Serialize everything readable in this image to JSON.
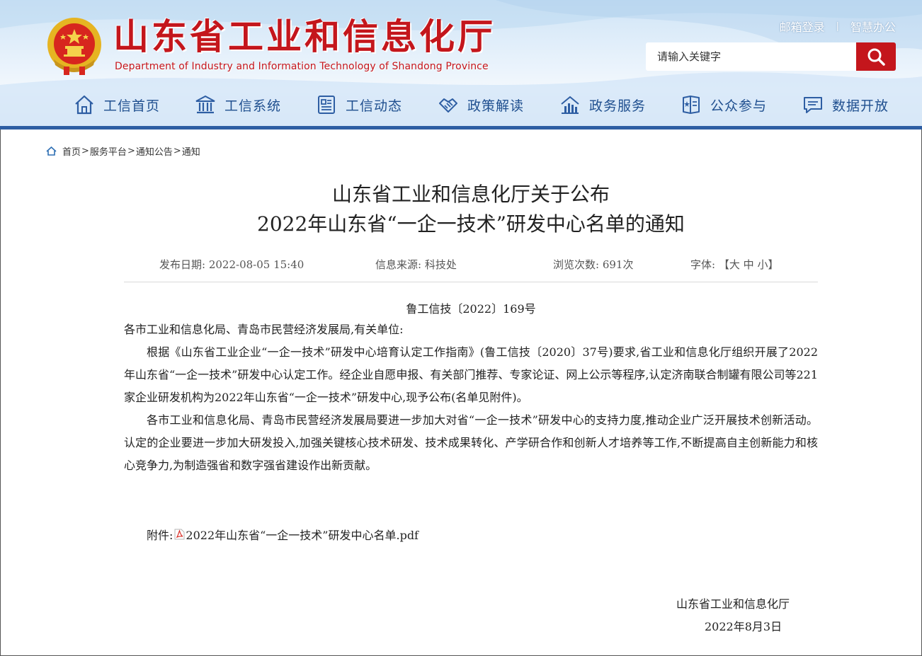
{
  "header": {
    "site_title": "山东省工业和信息化厅",
    "site_subtitle": "Department of Industry and Information Technology of Shandong Province",
    "links": {
      "mail_login": "邮箱登录",
      "separator": "|",
      "smart_office": "智慧办公"
    },
    "search": {
      "placeholder": "请输入关键字"
    },
    "nav": [
      {
        "label": "工信首页",
        "icon": "house-icon"
      },
      {
        "label": "工信系统",
        "icon": "building-icon"
      },
      {
        "label": "工信动态",
        "icon": "newspaper-icon"
      },
      {
        "label": "政策解读",
        "icon": "handshake-icon"
      },
      {
        "label": "政务服务",
        "icon": "chart-building-icon"
      },
      {
        "label": "公众参与",
        "icon": "booklet-icon"
      },
      {
        "label": "数据开放",
        "icon": "chat-icon"
      }
    ],
    "colors": {
      "brand_red": "#c4161c",
      "nav_blue": "#1f4f8f",
      "bar_blue": "#2e5ea3"
    }
  },
  "breadcrumb": {
    "items": [
      "首页",
      "服务平台",
      "通知公告",
      "通知"
    ],
    "separator": ">"
  },
  "article": {
    "title_line1": "山东省工业和信息化厅关于公布",
    "title_line2": "2022年山东省“一企一技术”研发中心名单的通知",
    "meta": {
      "publish_label": "发布日期:",
      "publish_date": "2022-08-05 15:40",
      "source_label": "信息来源:",
      "source": "科技处",
      "views_label": "浏览次数:",
      "views": "691次",
      "font_label": "字体:",
      "font_open": "【",
      "font_large": "大",
      "font_medium": "中",
      "font_small": "小",
      "font_close": "】"
    },
    "doc_number": "鲁工信技〔2022〕169号",
    "addressee": "各市工业和信息化局、青岛市民营经济发展局,有关单位:",
    "paragraph1": "根据《山东省工业企业“一企一技术”研发中心培育认定工作指南》(鲁工信技〔2020〕37号)要求,省工业和信息化厅组织开展了2022年山东省“一企一技术”研发中心认定工作。经企业自愿申报、有关部门推荐、专家论证、网上公示等程序,认定济南联合制罐有限公司等221家企业研发机构为2022年山东省“一企一技术”研发中心,现予公布(名单见附件)。",
    "paragraph2": "各市工业和信息化局、青岛市民营经济发展局要进一步加大对省“一企一技术”研发中心的支持力度,推动企业广泛开展技术创新活动。认定的企业要进一步加大研发投入,加强关键核心技术研发、技术成果转化、产学研合作和创新人才培养等工作,不断提高自主创新能力和核心竞争力,为制造强省和数字强省建设作出新贡献。",
    "attachment_label": "附件:",
    "attachment_file": "2022年山东省“一企一技术”研发中心名单.pdf",
    "signature": "山东省工业和信息化厅",
    "date": "2022年8月3日"
  }
}
